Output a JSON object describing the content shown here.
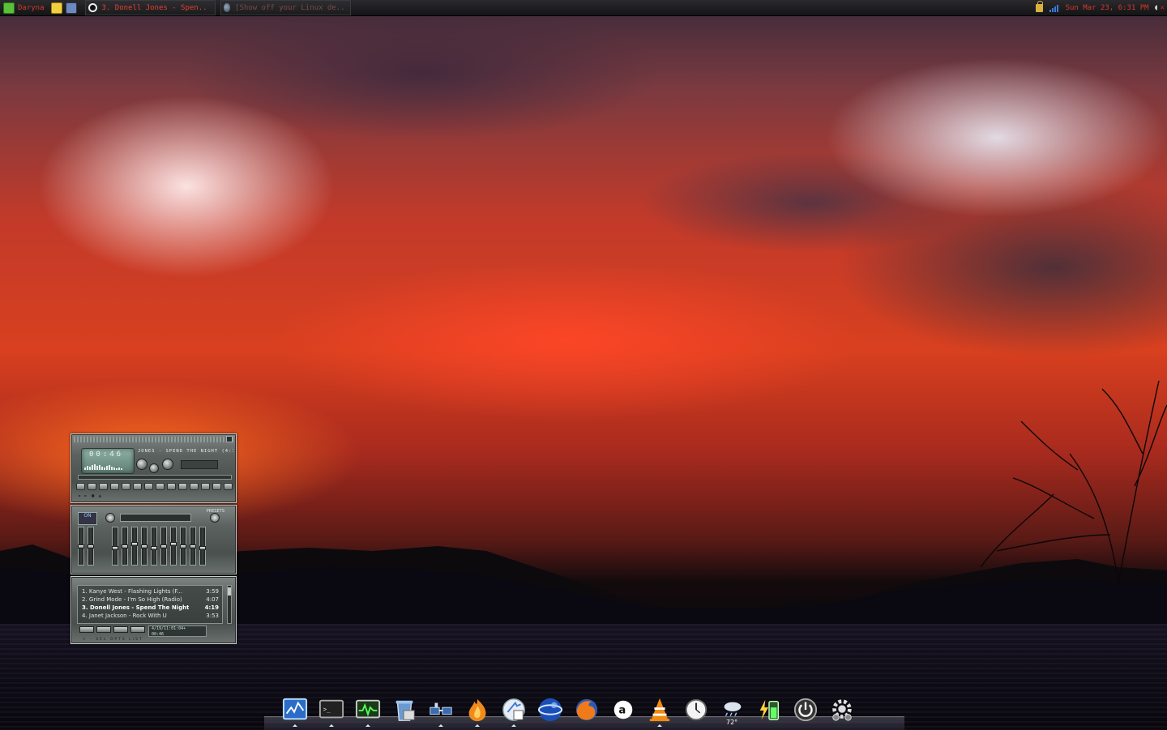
{
  "top_panel": {
    "user_label": "Daryna",
    "tasks": [
      {
        "label": "3. Donell Jones - Spen..",
        "icon": "music-player-icon"
      },
      {
        "label": "[Show off your Linux de..",
        "icon": "browser-icon"
      }
    ],
    "clock": "Sun Mar 23,  6:31 PM",
    "colors": {
      "accent": "#d23a2a",
      "panel_bg": "#1c1c1f"
    }
  },
  "player": {
    "time": "00:46",
    "marquee": "JONES - SPEND THE NIGHT (4:19)",
    "kbps": "  ",
    "controls_labels": "◄ ► ■ ▲",
    "eq": {
      "on_label": "ON",
      "presets_label": "PRESETS",
      "preamp_level": 0.5,
      "band_levels": [
        0.45,
        0.5,
        0.55,
        0.5,
        0.45,
        0.5,
        0.55,
        0.5,
        0.5,
        0.45
      ]
    },
    "playlist": [
      {
        "title": "1. Kanye West - Flashing Lights (F...",
        "length": "3:59"
      },
      {
        "title": "2. Grind Mode - I'm So High (Radio)",
        "length": "4:07"
      },
      {
        "title": "3. Donell Jones - Spend The Night",
        "length": "4:19"
      },
      {
        "title": "4. Janet Jackson - Rock With U",
        "length": "3:53"
      }
    ],
    "current_index": 2,
    "playlist_info": "4/19/11:01:04+",
    "playlist_time": "00:46",
    "playlist_buttons": "+  -  SEL  OPTS  LIST"
  },
  "dock": {
    "items": [
      {
        "name": "system-monitor-icon",
        "running": true
      },
      {
        "name": "terminal-icon",
        "running": true
      },
      {
        "name": "activity-monitor-icon",
        "running": true
      },
      {
        "name": "trash-icon",
        "running": false
      },
      {
        "name": "network-icon",
        "running": true
      },
      {
        "name": "firefox-flame-icon",
        "running": true
      },
      {
        "name": "finder-icon",
        "running": true
      },
      {
        "name": "globe-icon",
        "running": false
      },
      {
        "name": "firefox-icon",
        "running": false
      },
      {
        "name": "amazon-icon",
        "running": false
      },
      {
        "name": "vlc-icon",
        "running": true
      },
      {
        "name": "clock-icon",
        "running": false
      },
      {
        "name": "weather-icon",
        "running": false
      },
      {
        "name": "battery-icon",
        "running": false
      },
      {
        "name": "power-icon",
        "running": false
      },
      {
        "name": "settings-gear-icon",
        "running": false
      }
    ],
    "weather_temp": "72°"
  }
}
